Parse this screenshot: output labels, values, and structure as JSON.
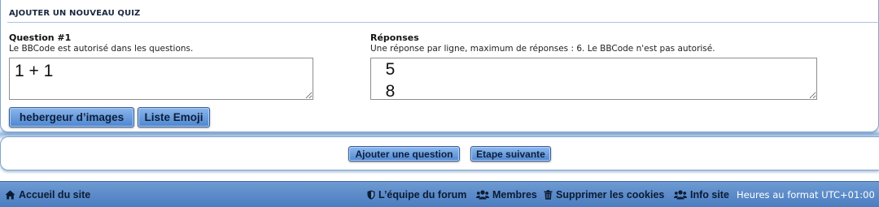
{
  "quiz_panel": {
    "title": "AJOUTER UN NOUVEAU QUIZ",
    "question": {
      "heading": "Question #1",
      "note": "Le BBCode est autorisé dans les questions.",
      "value": "1 + 1"
    },
    "answers": {
      "heading": "Réponses",
      "note": "Une réponse par ligne, maximum de réponses : 6. Le BBCode n'est pas autorisé.",
      "value": "  5\n  8"
    },
    "tool_buttons": {
      "image_host": "hebergeur d’images",
      "emoji_list": "Liste Emoji"
    }
  },
  "actions": {
    "add_question": "Ajouter une question",
    "next_step": "Etape suivante"
  },
  "footer": {
    "home": "Accueil du site",
    "team": "L’équipe du forum",
    "members": "Membres",
    "delete_cookies": "Supprimer les cookies",
    "info": "Info site",
    "timezone": "Heures au format UTC+01:00"
  },
  "icons": {
    "home": "home-icon",
    "team": "shield-icon",
    "members": "users-icon",
    "delete_cookies": "trash-icon",
    "info": "users-icon"
  },
  "colors": {
    "accent": "#4d86cf",
    "footer": "#5b8ac8",
    "panel_border": "#7fa4cf"
  }
}
